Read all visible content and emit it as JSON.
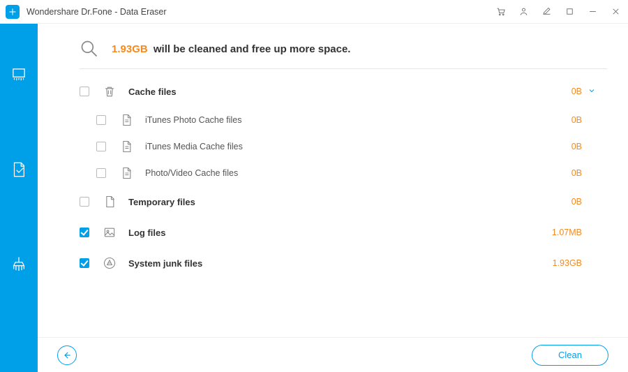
{
  "app": {
    "title": "Wondershare Dr.Fone - Data Eraser"
  },
  "summary": {
    "size": "1.93GB",
    "suffix": "will be cleaned and free up more space."
  },
  "categories": [
    {
      "id": "cache",
      "label": "Cache files",
      "size": "0B",
      "checked": false,
      "icon": "trash",
      "expanded": true,
      "children": [
        {
          "id": "itunes-photo",
          "label": "iTunes Photo Cache files",
          "size": "0B",
          "checked": false
        },
        {
          "id": "itunes-media",
          "label": "iTunes Media Cache files",
          "size": "0B",
          "checked": false
        },
        {
          "id": "photo-video",
          "label": "Photo/Video Cache files",
          "size": "0B",
          "checked": false
        }
      ]
    },
    {
      "id": "temp",
      "label": "Temporary files",
      "size": "0B",
      "checked": false,
      "icon": "file",
      "children": []
    },
    {
      "id": "log",
      "label": "Log files",
      "size": "1.07MB",
      "checked": true,
      "icon": "image",
      "children": []
    },
    {
      "id": "junk",
      "label": "System junk files",
      "size": "1.93GB",
      "checked": true,
      "icon": "appstore",
      "children": []
    }
  ],
  "footer": {
    "clean": "Clean"
  }
}
